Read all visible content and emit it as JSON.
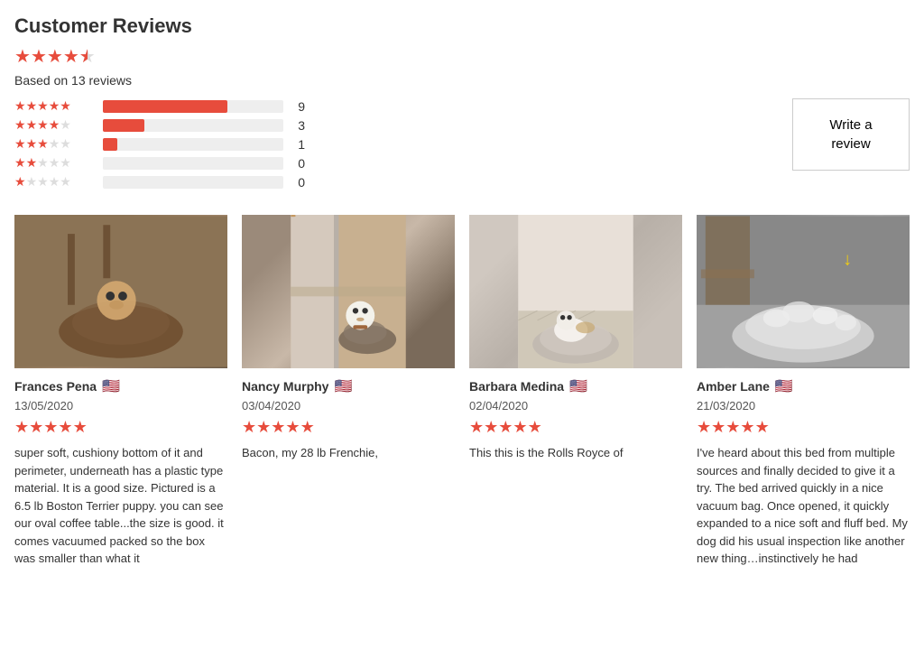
{
  "header": {
    "title": "Customer Reviews",
    "based_on": "Based on 13 reviews"
  },
  "overall_rating": {
    "value": 4.5,
    "full_stars": 4,
    "half_star": true
  },
  "rating_bars": [
    {
      "stars": 5,
      "filled": 5,
      "empty": 0,
      "count": 9,
      "percent": 69
    },
    {
      "stars": 4,
      "filled": 4,
      "empty": 1,
      "count": 3,
      "percent": 23
    },
    {
      "stars": 3,
      "filled": 3,
      "empty": 2,
      "count": 1,
      "percent": 8
    },
    {
      "stars": 2,
      "filled": 2,
      "empty": 3,
      "count": 0,
      "percent": 0
    },
    {
      "stars": 1,
      "filled": 1,
      "empty": 4,
      "count": 0,
      "percent": 0
    }
  ],
  "write_review_label": "Write a review",
  "reviews": [
    {
      "name": "Frances Pena",
      "flag": "🇺🇸",
      "date": "13/05/2020",
      "stars": 5,
      "text": "super soft, cushiony bottom of it and perimeter, underneath has a plastic type material. It is a good size. Pictured is a 6.5 lb Boston Terrier puppy. you can see our oval coffee table...the size is good. it comes vacuumed packed so the box was smaller than what it",
      "img_color": "img-placeholder-1"
    },
    {
      "name": "Nancy Murphy",
      "flag": "🇺🇸",
      "date": "03/04/2020",
      "stars": 5,
      "text": "Bacon, my 28 lb Frenchie,",
      "img_color": "img-placeholder-2"
    },
    {
      "name": "Barbara Medina",
      "flag": "🇺🇸",
      "date": "02/04/2020",
      "stars": 5,
      "text": "This this is the Rolls Royce of",
      "img_color": "img-placeholder-3"
    },
    {
      "name": "Amber Lane",
      "flag": "🇺🇸",
      "date": "21/03/2020",
      "stars": 5,
      "text": "I've heard about this bed from multiple sources and finally decided to give it a try. The bed arrived quickly in a nice vacuum bag. Once opened, it quickly expanded to a nice soft and fluff bed. My dog did his usual inspection like another new thing…instinctively he had",
      "img_color": "img-placeholder-4"
    }
  ]
}
